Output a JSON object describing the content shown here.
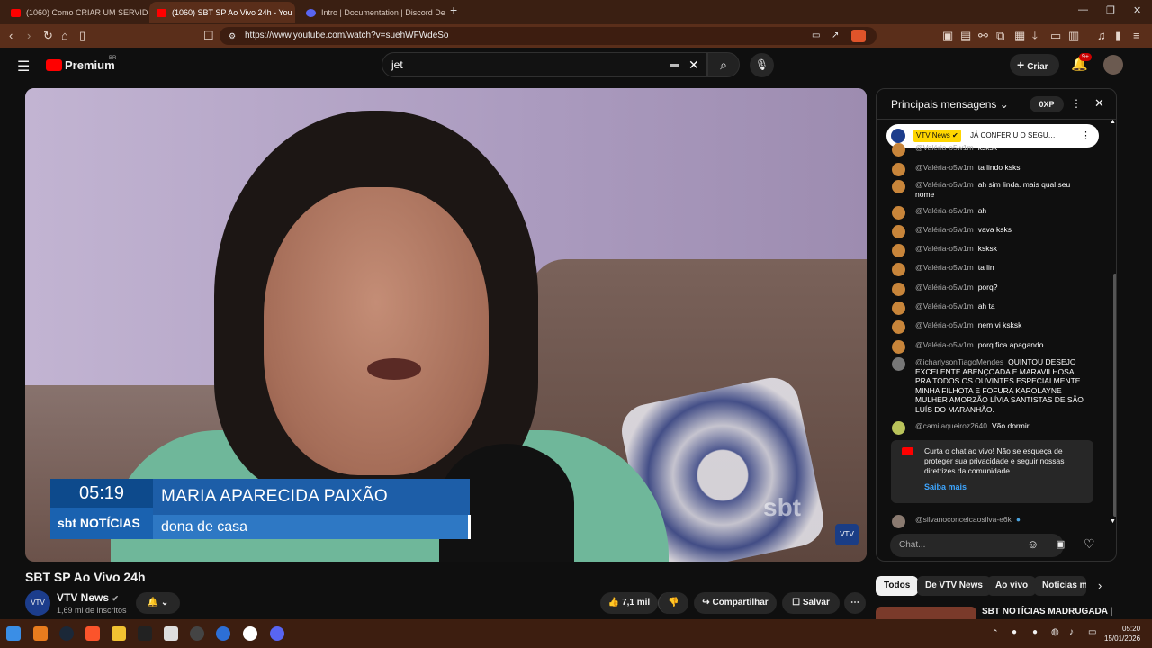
{
  "browser": {
    "tabs": [
      {
        "label": "(1060) Como CRIAR UM SERVIDOR D",
        "active": false
      },
      {
        "label": "(1060) SBT SP Ao Vivo 24h - You",
        "active": true
      },
      {
        "label": "Intro | Documentation | Discord Deve",
        "active": false
      }
    ],
    "new_tab": "+",
    "url": "https://www.youtube.com/watch?v=suehWFWdeSo"
  },
  "yt": {
    "logo": "Premium",
    "region": "BR",
    "search_value": "jet",
    "create_label": "Criar",
    "notif_badge": "9+"
  },
  "video": {
    "lower_third_time": "05:19",
    "lower_third_logo": "sbt NOTÍCIAS",
    "lower_third_name": "MARIA APARECIDA PAIXÃO",
    "lower_third_role": "dona de casa",
    "watermark": "sbt",
    "title": "SBT SP Ao Vivo 24h"
  },
  "channel": {
    "name": "VTV News",
    "subs": "1,69 mi de inscritos",
    "avatar": "VTV"
  },
  "actions": {
    "likes": "7,1 mil",
    "share": "Compartilhar",
    "save": "Salvar"
  },
  "chat": {
    "title": "Principais mensagens",
    "xp": "0XP",
    "pinned_author": "VTV News",
    "pinned_text": "JÁ CONFERIU O SEGU…",
    "messages": [
      {
        "author": "@Valéria-o5w1m",
        "text": "ksksk"
      },
      {
        "author": "@Valéria-o5w1m",
        "text": "ta lindo ksks"
      },
      {
        "author": "@Valéria-o5w1m",
        "text": "ah sim linda. mais qual seu nome"
      },
      {
        "author": "@Valéria-o5w1m",
        "text": "ah"
      },
      {
        "author": "@Valéria-o5w1m",
        "text": "vava ksks"
      },
      {
        "author": "@Valéria-o5w1m",
        "text": "ksksk"
      },
      {
        "author": "@Valéria-o5w1m",
        "text": "ta lin"
      },
      {
        "author": "@Valéria-o5w1m",
        "text": "porq?"
      },
      {
        "author": "@Valéria-o5w1m",
        "text": "ah ta"
      },
      {
        "author": "@Valéria-o5w1m",
        "text": "nem vi ksksk"
      },
      {
        "author": "@Valéria-o5w1m",
        "text": "porq fica apagando"
      },
      {
        "author": "@icharlysonTiagoMendes",
        "text": "QUINTOU DESEJO EXCELENTE ABENÇOADA E MARAVILHOSA PRA TODOS OS OUVINTES ESPECIALMENTE MINHA FILHOTA E FOFURA KAROLAYNE MULHER AMORZÃO LÍVIA SANTISTAS DE SÃO LUÍS DO MARANHÃO."
      },
      {
        "author": "@camilaqueiroz2640",
        "text": "Vão dormir"
      }
    ],
    "notice_text": "Curta o chat ao vivo! Não se esqueça de proteger sua privacidade e seguir nossas diretrizes da comunidade.",
    "notice_link": "Saiba mais",
    "last_author": "@silvanoconceicaosilva-e6k",
    "input_placeholder": "Chat..."
  },
  "chips": [
    "Todos",
    "De VTV News",
    "Ao vivo",
    "Notícias m"
  ],
  "rec_title": "SBT NOTÍCIAS MADRUGADA |",
  "taskbar": {
    "time": "05:20",
    "date": "15/01/2026"
  },
  "colors": {
    "accent": "#ff0000",
    "link": "#3ea6ff",
    "browser_frame": "#5a2e1a"
  }
}
